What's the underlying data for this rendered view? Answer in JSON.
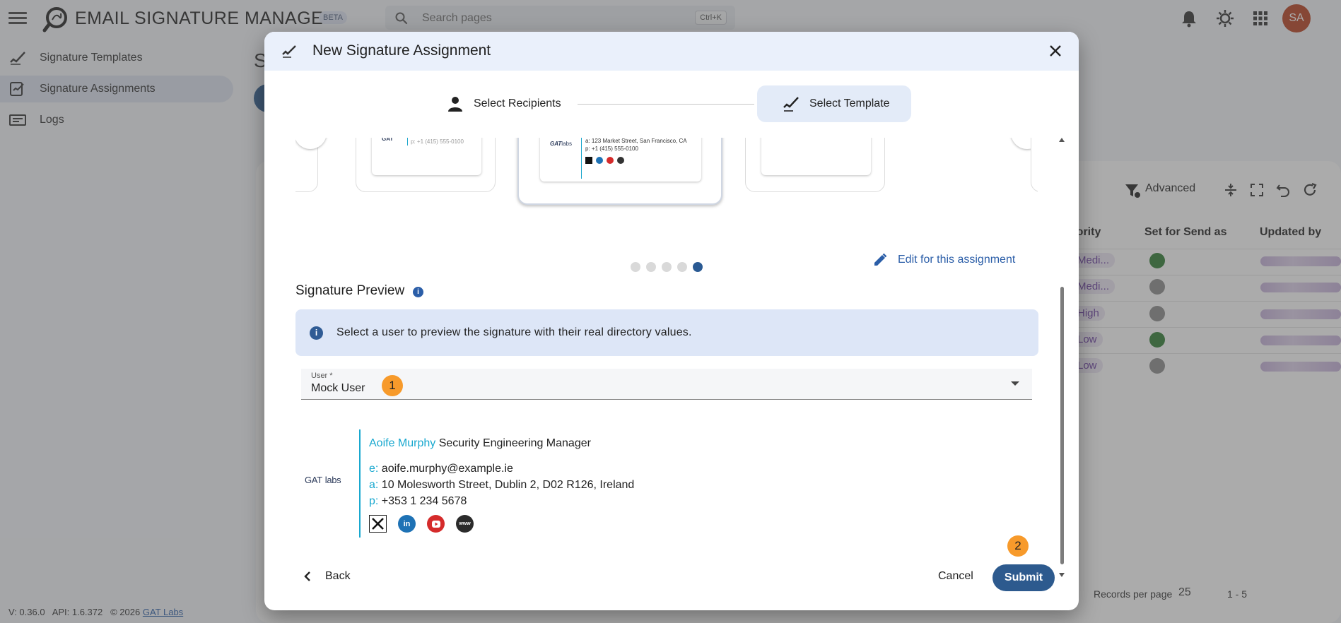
{
  "app": {
    "title": "EMAIL SIGNATURE MANAGER",
    "badge": "BETA",
    "search_placeholder": "Search pages",
    "search_shortcut": "Ctrl+K",
    "avatar_initials": "SA",
    "avatar_color": "#b8401f"
  },
  "sidebar": {
    "items": [
      {
        "label": "Signature Templates",
        "icon": "signature-pen-icon"
      },
      {
        "label": "Signature Assignments",
        "icon": "assignment-icon",
        "active": true
      },
      {
        "label": "Logs",
        "icon": "logs-icon"
      }
    ]
  },
  "page": {
    "title_partial": "S"
  },
  "table": {
    "toolbar_advanced": "Advanced",
    "columns": [
      "riority",
      "Set for Send as",
      "Updated by"
    ],
    "rows": [
      {
        "priority": "Medi...",
        "send_as": true
      },
      {
        "priority": "Medi...",
        "send_as": false
      },
      {
        "priority": "High",
        "send_as": false
      },
      {
        "priority": "Low",
        "send_as": true
      },
      {
        "priority": "Low",
        "send_as": false
      }
    ],
    "records_per_page_label": "Records per page",
    "records_per_page": "25",
    "range": "1 - 5"
  },
  "footer": {
    "version": "V: 0.36.0",
    "api": "API: 1.6.372",
    "copyright": "© 2026",
    "link": "GAT Labs"
  },
  "dialog": {
    "title": "New Signature Assignment",
    "steps": [
      {
        "label": "Select Recipients",
        "icon": "person-icon"
      },
      {
        "label": "Select Template",
        "icon": "signature-pen-icon",
        "active": true
      }
    ],
    "carousel": {
      "active_index": 4,
      "count": 5,
      "cards": [
        {
          "address": "a: 123 Market Street, San Francisco, CA",
          "phone": "p: +1 (415) 555-0100"
        }
      ]
    },
    "edit_link": "Edit for this assignment",
    "preview_title": "Signature Preview",
    "alert_text": "Select a user to preview the signature with their real directory values.",
    "user_field": {
      "label": "User *",
      "value": "Mock User"
    },
    "signature": {
      "logo_bold": "GAT",
      "logo_light": "labs",
      "name": "Aoife Murphy",
      "job_title": "Security Engineering Manager",
      "email_key": "e:",
      "email": "aoife.murphy@example.ie",
      "address_key": "a:",
      "address": "10 Molesworth Street, Dublin 2, D02 R126, Ireland",
      "phone_key": "p:",
      "phone": "+353 1 234 5678",
      "accent_color": "#19a8cf",
      "social": [
        "x-icon",
        "linkedin-icon",
        "youtube-icon",
        "www-icon"
      ]
    },
    "badges": [
      "1",
      "2"
    ],
    "buttons": {
      "back": "Back",
      "cancel": "Cancel",
      "submit": "Submit"
    }
  }
}
